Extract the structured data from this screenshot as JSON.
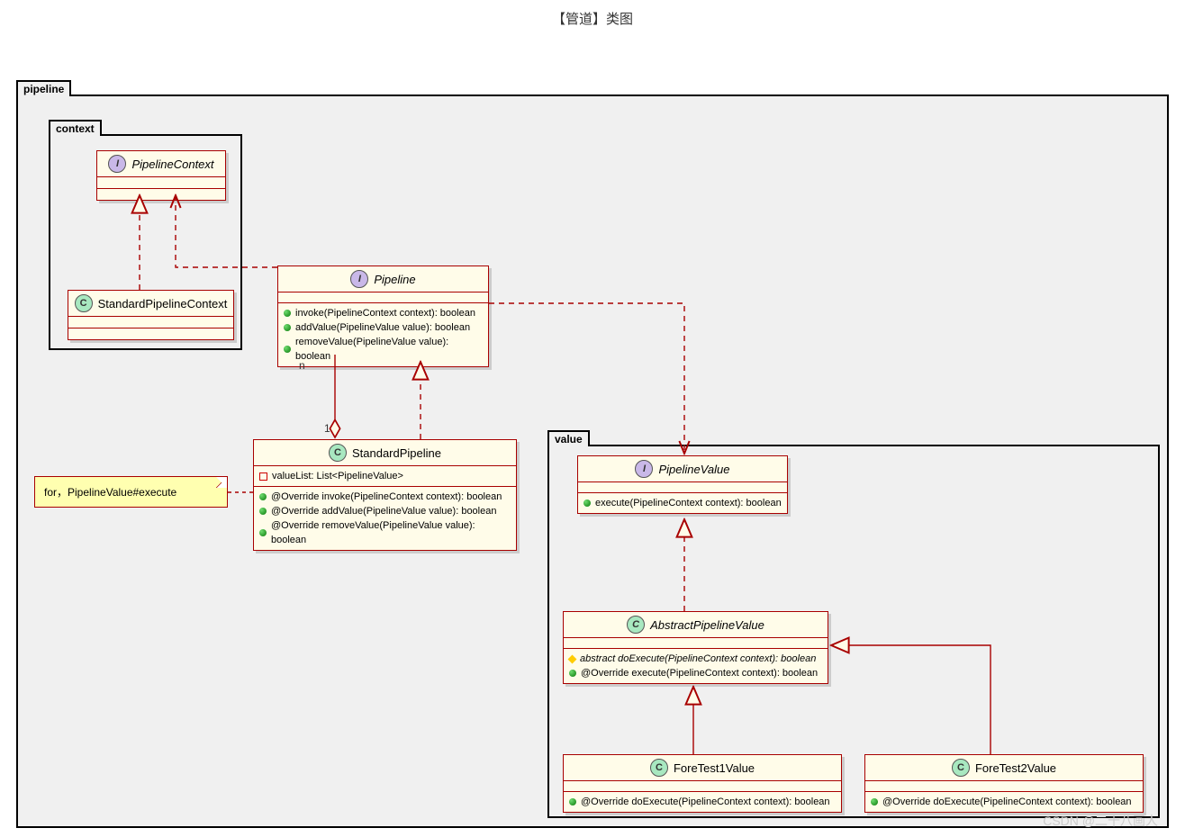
{
  "title": "【管道】类图",
  "packages": {
    "pipeline": {
      "label": "pipeline"
    },
    "context": {
      "label": "context"
    },
    "value": {
      "label": "value"
    }
  },
  "classes": {
    "PipelineContext": {
      "type": "I",
      "name": "PipelineContext"
    },
    "StandardPipelineContext": {
      "type": "C",
      "name": "StandardPipelineContext"
    },
    "Pipeline": {
      "type": "I",
      "name": "Pipeline",
      "methods": [
        "invoke(PipelineContext context): boolean",
        "addValue(PipelineValue value): boolean",
        "removeValue(PipelineValue value): boolean"
      ]
    },
    "StandardPipeline": {
      "type": "C",
      "name": "StandardPipeline",
      "attrs": [
        "valueList: List<PipelineValue>"
      ],
      "methods": [
        "@Override invoke(PipelineContext context): boolean",
        "@Override addValue(PipelineValue value): boolean",
        "@Override removeValue(PipelineValue value): boolean"
      ]
    },
    "PipelineValue": {
      "type": "I",
      "name": "PipelineValue",
      "methods": [
        "execute(PipelineContext context): boolean"
      ]
    },
    "AbstractPipelineValue": {
      "type": "C",
      "name": "AbstractPipelineValue",
      "methods": [
        {
          "kind": "abstract",
          "sig": "abstract doExecute(PipelineContext context): boolean"
        },
        {
          "kind": "normal",
          "sig": "@Override execute(PipelineContext context): boolean"
        }
      ]
    },
    "ForeTest1Value": {
      "type": "C",
      "name": "ForeTest1Value",
      "methods": [
        "@Override doExecute(PipelineContext context): boolean"
      ]
    },
    "ForeTest2Value": {
      "type": "C",
      "name": "ForeTest2Value",
      "methods": [
        "@Override doExecute(PipelineContext context): boolean"
      ]
    }
  },
  "note": {
    "text": "for，PipelineValue#execute"
  },
  "multiplicity": {
    "n": "n",
    "one": "1"
  },
  "watermark": "CSDN @二十八画人",
  "chart_data": {
    "type": "diagram",
    "diagram_type": "UML class diagram",
    "packages": [
      {
        "name": "pipeline",
        "contains": [
          "context",
          "value",
          "Pipeline",
          "StandardPipeline"
        ]
      },
      {
        "name": "context",
        "contains": [
          "PipelineContext",
          "StandardPipelineContext"
        ]
      },
      {
        "name": "value",
        "contains": [
          "PipelineValue",
          "AbstractPipelineValue",
          "ForeTest1Value",
          "ForeTest2Value"
        ]
      }
    ],
    "nodes": [
      {
        "id": "PipelineContext",
        "stereotype": "interface"
      },
      {
        "id": "StandardPipelineContext",
        "stereotype": "class"
      },
      {
        "id": "Pipeline",
        "stereotype": "interface",
        "methods": [
          "invoke(PipelineContext): boolean",
          "addValue(PipelineValue): boolean",
          "removeValue(PipelineValue): boolean"
        ]
      },
      {
        "id": "StandardPipeline",
        "stereotype": "class",
        "attributes": [
          "valueList: List<PipelineValue>"
        ],
        "methods": [
          "@Override invoke(PipelineContext): boolean",
          "@Override addValue(PipelineValue): boolean",
          "@Override removeValue(PipelineValue): boolean"
        ]
      },
      {
        "id": "PipelineValue",
        "stereotype": "interface",
        "methods": [
          "execute(PipelineContext): boolean"
        ]
      },
      {
        "id": "AbstractPipelineValue",
        "stereotype": "abstract class",
        "methods": [
          "abstract doExecute(PipelineContext): boolean",
          "@Override execute(PipelineContext): boolean"
        ]
      },
      {
        "id": "ForeTest1Value",
        "stereotype": "class",
        "methods": [
          "@Override doExecute(PipelineContext): boolean"
        ]
      },
      {
        "id": "ForeTest2Value",
        "stereotype": "class",
        "methods": [
          "@Override doExecute(PipelineContext): boolean"
        ]
      }
    ],
    "edges": [
      {
        "from": "StandardPipelineContext",
        "to": "PipelineContext",
        "type": "realization"
      },
      {
        "from": "Pipeline",
        "to": "PipelineContext",
        "type": "dependency"
      },
      {
        "from": "StandardPipeline",
        "to": "Pipeline",
        "type": "realization"
      },
      {
        "from": "StandardPipeline",
        "to": "Pipeline",
        "type": "aggregation",
        "from_mult": "1",
        "to_mult": "n"
      },
      {
        "from": "Pipeline",
        "to": "PipelineValue",
        "type": "dependency"
      },
      {
        "from": "AbstractPipelineValue",
        "to": "PipelineValue",
        "type": "realization"
      },
      {
        "from": "ForeTest1Value",
        "to": "AbstractPipelineValue",
        "type": "generalization"
      },
      {
        "from": "ForeTest2Value",
        "to": "AbstractPipelineValue",
        "type": "generalization"
      }
    ],
    "notes": [
      {
        "text": "for，PipelineValue#execute",
        "attached_to": "StandardPipeline"
      }
    ]
  }
}
